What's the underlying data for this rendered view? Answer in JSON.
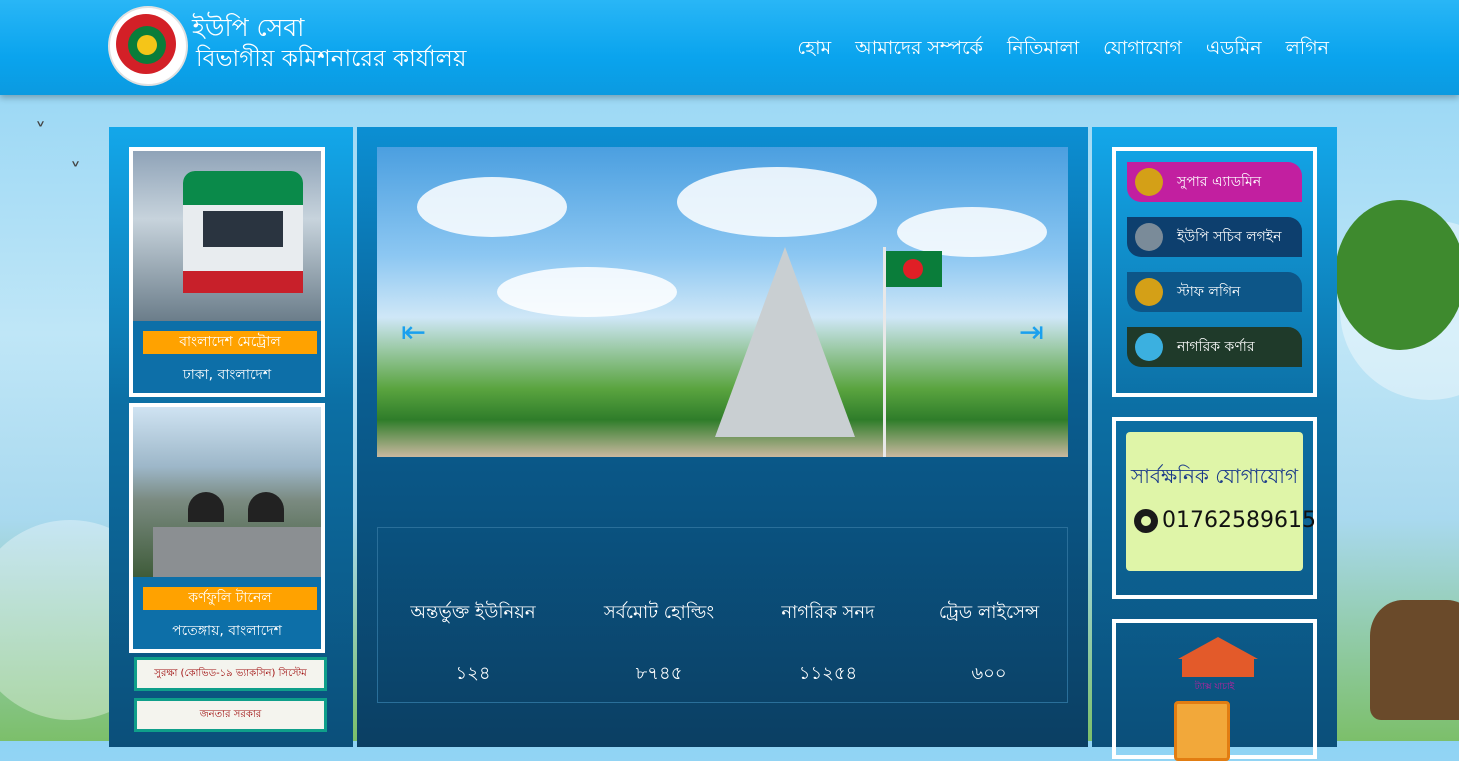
{
  "header": {
    "title": "ইউপি সেবা",
    "subtitle": "বিভাগীয় কমিশনারের কার্যালয়"
  },
  "nav": {
    "items": [
      "হোম",
      "আমাদের সম্পর্কে",
      "নিতিমালা",
      "যোগাযোগ",
      "এডমিন",
      "লগিন"
    ]
  },
  "left": {
    "cards": [
      {
        "badge": "বাংলাদেশ মেট্রোল",
        "location": "ঢাকা, বাংলাদেশ"
      },
      {
        "badge": "কর্ণফুলি টানেল",
        "location": "পতেঙ্গায়, বাংলাদেশ"
      }
    ],
    "banners": [
      "সুরক্ষা (কোভিড-১৯ ভ্যাকসিন) সিস্টেম",
      "জনতার সরকার"
    ]
  },
  "slider": {
    "prev": "⇤",
    "next": "⇥"
  },
  "stats": [
    {
      "label": "অন্তর্ভুক্ত ইউনিয়ন",
      "value": "১২৪"
    },
    {
      "label": "সর্বমোট হোল্ডিং",
      "value": "৮৭৪৫"
    },
    {
      "label": "নাগরিক সনদ",
      "value": "১১২৫৪"
    },
    {
      "label": "ট্রেড লাইসেন্স",
      "value": "৬০০"
    }
  ],
  "right": {
    "menu": [
      {
        "label": "সুপার এ্যাডমিন",
        "color": "#c21fa0"
      },
      {
        "label": "ইউপি সচিব লগইন",
        "color": "#0d3f6e"
      },
      {
        "label": "স্টাফ লগিন",
        "color": "#0d5688"
      },
      {
        "label": "নাগরিক কর্ণার",
        "color": "#1f3a2a"
      }
    ],
    "contact": {
      "title": "সার্বক্ষনিক যোগাযোগ",
      "phone": "01762589615"
    },
    "tax": {
      "label": "ট্যাক্স যাচাই"
    }
  }
}
